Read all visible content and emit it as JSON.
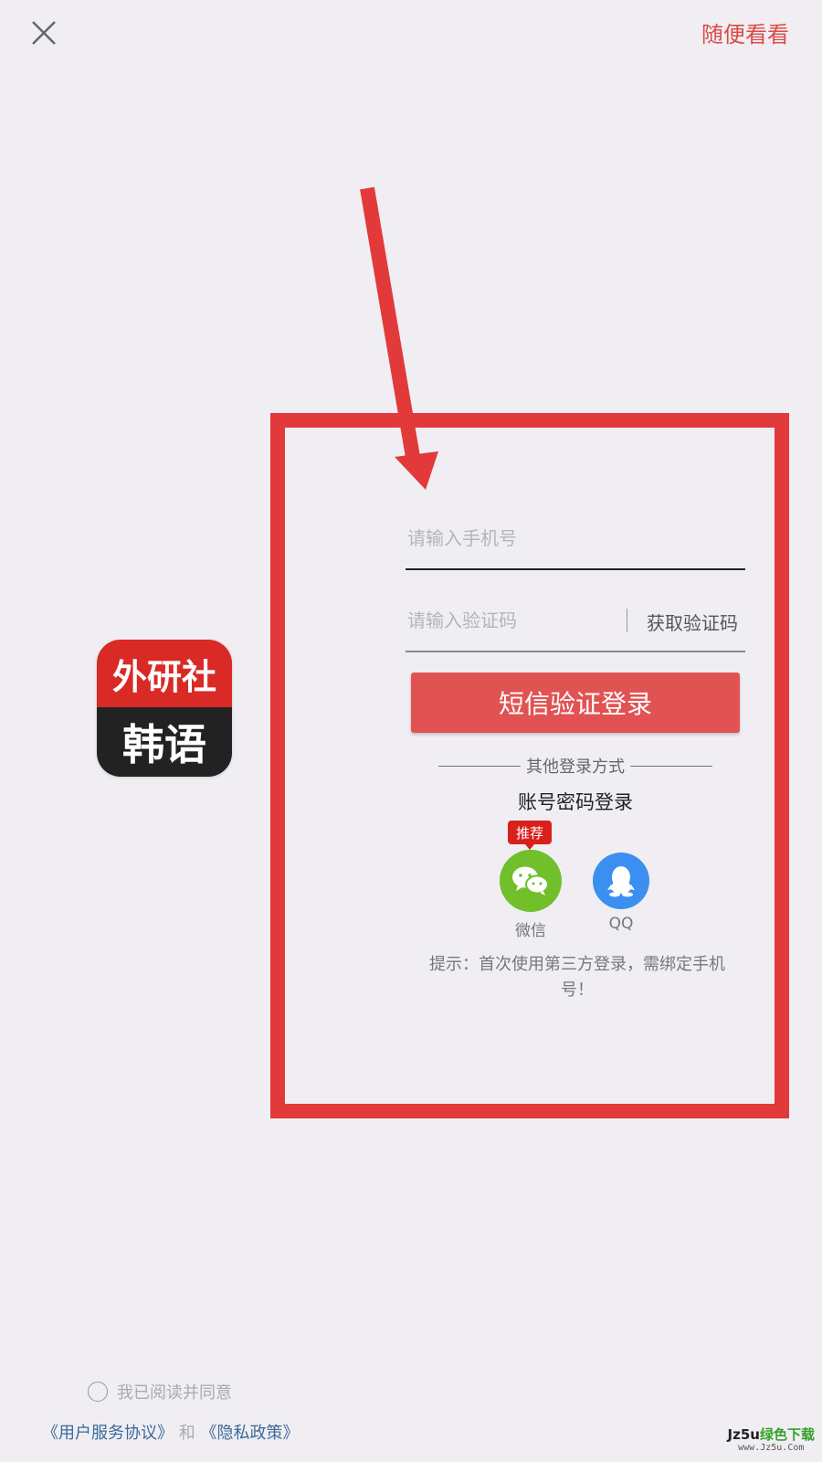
{
  "header": {
    "browse_label": "随便看看"
  },
  "logo": {
    "line1": "外研社",
    "line2": "韩语"
  },
  "login_form": {
    "phone_placeholder": "请输入手机号",
    "code_placeholder": "请输入验证码",
    "get_code_label": "获取验证码",
    "submit_label": "短信验证登录"
  },
  "other_login": {
    "title": "其他登录方式",
    "account_password_label": "账号密码登录",
    "recommend_badge": "推荐",
    "wechat_label": "微信",
    "qq_label": "QQ",
    "tip": "提示：首次使用第三方登录，需绑定手机号！"
  },
  "agreement": {
    "checkbox_label": "我已阅读并同意",
    "user_agreement_link": "《用户服务协议》",
    "and_text": "和",
    "privacy_link": "《隐私政策》"
  },
  "watermark": {
    "brand_prefix": "Jz5u",
    "brand_suffix": "绿色下载",
    "url": "www.Jz5u.Com"
  },
  "colors": {
    "accent": "#e15353",
    "annotation": "#e23a3a",
    "wechat": "#71bf2a",
    "qq": "#3b8ff0",
    "link": "#3b6a98"
  }
}
